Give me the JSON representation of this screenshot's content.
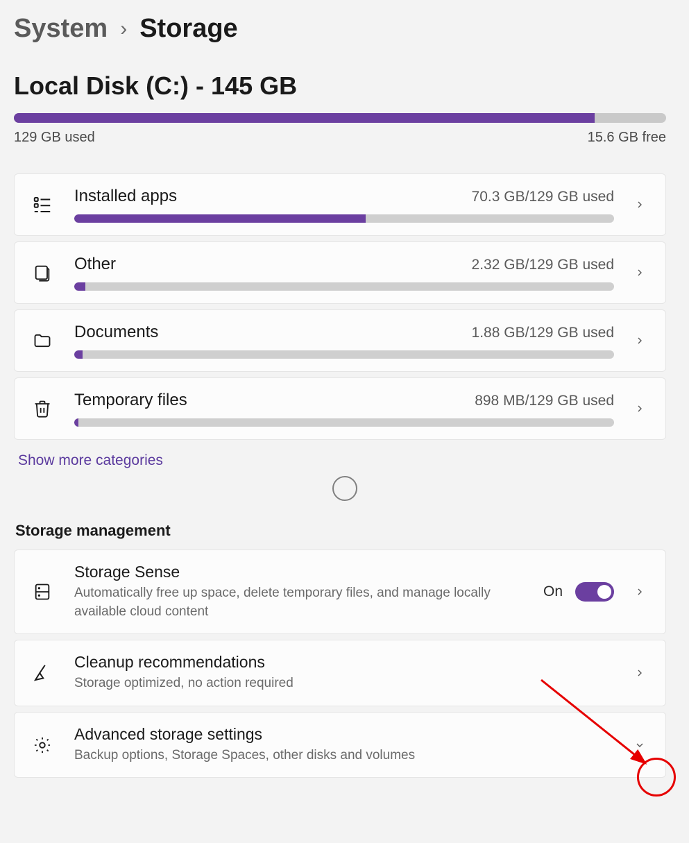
{
  "breadcrumb": {
    "parent": "System",
    "current": "Storage"
  },
  "disk": {
    "title": "Local Disk (C:) - 145 GB",
    "used_label": "129 GB used",
    "free_label": "15.6 GB free",
    "fill_percent": 89
  },
  "categories": [
    {
      "icon": "apps-list-icon",
      "title": "Installed apps",
      "usage": "70.3 GB/129 GB used",
      "percent": 54
    },
    {
      "icon": "other-icon",
      "title": "Other",
      "usage": "2.32 GB/129 GB used",
      "percent": 2
    },
    {
      "icon": "documents-icon",
      "title": "Documents",
      "usage": "1.88 GB/129 GB used",
      "percent": 1.5
    },
    {
      "icon": "trash-icon",
      "title": "Temporary files",
      "usage": "898 MB/129 GB used",
      "percent": 0.8
    }
  ],
  "show_more_label": "Show more categories",
  "section_title": "Storage management",
  "management": {
    "sense": {
      "title": "Storage Sense",
      "desc": "Automatically free up space, delete temporary files, and manage locally available cloud content",
      "state_label": "On",
      "enabled": true
    },
    "cleanup": {
      "title": "Cleanup recommendations",
      "desc": "Storage optimized, no action required"
    },
    "advanced": {
      "title": "Advanced storage settings",
      "desc": "Backup options, Storage Spaces, other disks and volumes"
    }
  },
  "colors": {
    "accent": "#6b3fa0",
    "link": "#5b3a9e"
  }
}
